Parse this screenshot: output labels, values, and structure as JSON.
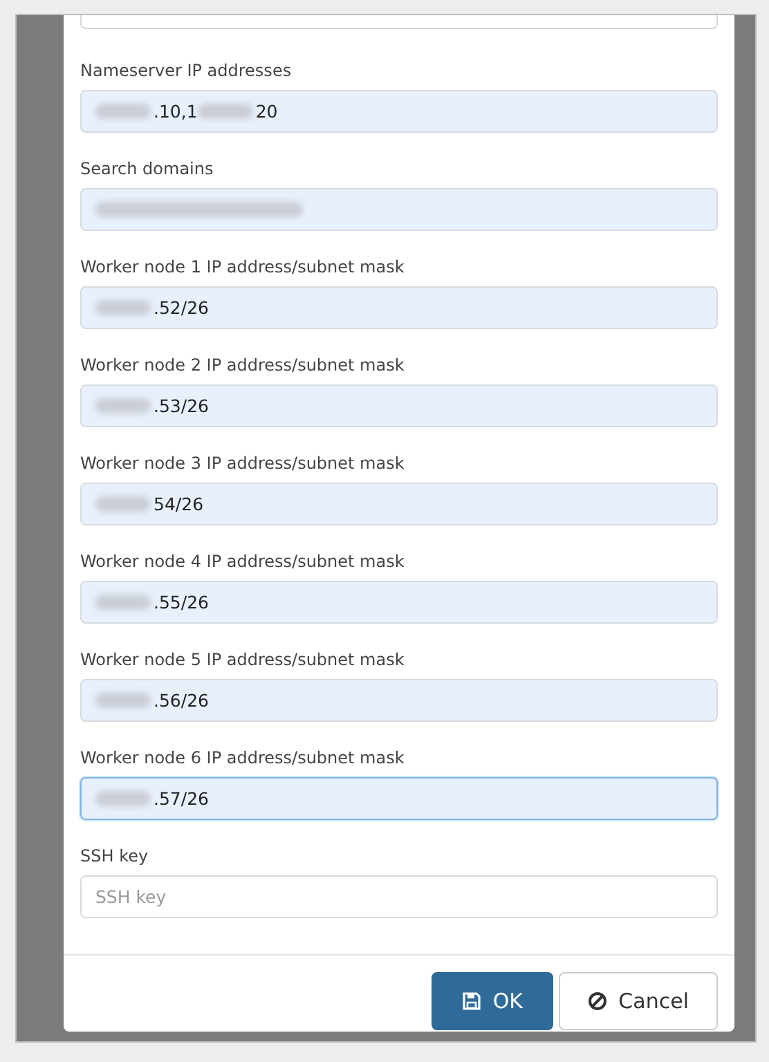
{
  "fields": [
    {
      "label": "Nameserver IP addresses",
      "focused": false,
      "segments": [
        {
          "kind": "blur"
        },
        {
          "kind": "text",
          "text": ".10,1"
        },
        {
          "kind": "blur"
        },
        {
          "kind": "text",
          "text": "20"
        }
      ]
    },
    {
      "label": "Search domains",
      "focused": false,
      "segments": [
        {
          "kind": "blur",
          "wide": true
        }
      ]
    },
    {
      "label": "Worker node 1 IP address/subnet mask",
      "focused": false,
      "segments": [
        {
          "kind": "blur"
        },
        {
          "kind": "text",
          "text": ".52/26"
        }
      ]
    },
    {
      "label": "Worker node 2 IP address/subnet mask",
      "focused": false,
      "segments": [
        {
          "kind": "blur"
        },
        {
          "kind": "text",
          "text": ".53/26"
        }
      ]
    },
    {
      "label": "Worker node 3 IP address/subnet mask",
      "focused": false,
      "segments": [
        {
          "kind": "blur"
        },
        {
          "kind": "text",
          "text": "54/26"
        }
      ]
    },
    {
      "label": "Worker node 4 IP address/subnet mask",
      "focused": false,
      "segments": [
        {
          "kind": "blur"
        },
        {
          "kind": "text",
          "text": ".55/26"
        }
      ]
    },
    {
      "label": "Worker node 5 IP address/subnet mask",
      "focused": false,
      "segments": [
        {
          "kind": "blur"
        },
        {
          "kind": "text",
          "text": ".56/26"
        }
      ]
    },
    {
      "label": "Worker node 6 IP address/subnet mask",
      "focused": true,
      "segments": [
        {
          "kind": "blur"
        },
        {
          "kind": "text",
          "text": ".57/26"
        }
      ]
    }
  ],
  "ssh_key": {
    "label": "SSH key",
    "placeholder": "SSH key"
  },
  "buttons": [
    {
      "label": "OK",
      "kind": "primary"
    },
    {
      "label": "Cancel",
      "kind": "secondary"
    }
  ]
}
